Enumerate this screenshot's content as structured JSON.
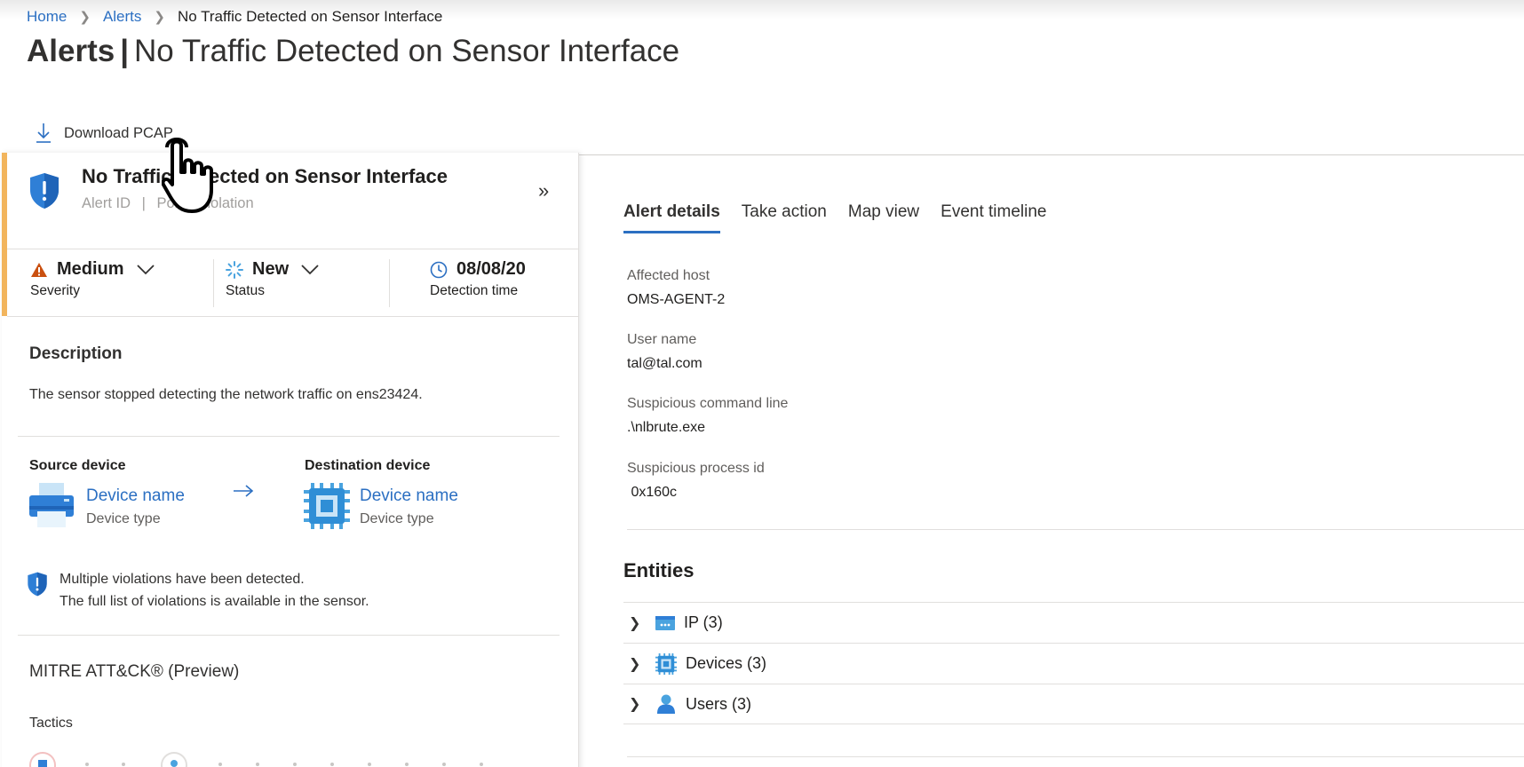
{
  "breadcrumb": {
    "home": "Home",
    "alerts": "Alerts",
    "current": "No Traffic Detected on Sensor Interface"
  },
  "page_title": {
    "prefix": "Alerts",
    "separator": "|",
    "name": "No Traffic Detected on Sensor Interface"
  },
  "command_bar": {
    "download_label": "Download PCAP",
    "icon": "download-icon"
  },
  "alert_panel": {
    "title": "No Traffic Detected on Sensor Interface",
    "alert_id_label": "Alert ID",
    "divider": "|",
    "policy_label": "Policy violation",
    "severity": {
      "value": "Medium",
      "label": "Severity",
      "color": "#ca5010"
    },
    "status": {
      "value": "New",
      "label": "Status"
    },
    "detection": {
      "value": "08/08/20",
      "label": "Detection time"
    },
    "accent_color": "#f2b55d",
    "description_title": "Description",
    "description_text": "The sensor stopped detecting the network traffic on ens23424.",
    "source": {
      "label": "Source device",
      "name": "Device name",
      "type": "Device type"
    },
    "destination": {
      "label": "Destination device",
      "name": "Device name",
      "type": "Device type"
    },
    "violations_line1": "Multiple violations have been detected.",
    "violations_line2": "The full list of violations is available in the sensor.",
    "mitre_title": "MITRE ATT&CK® (Preview)",
    "tactics_label": "Tactics"
  },
  "tabs": [
    {
      "label": "Alert details",
      "active": true
    },
    {
      "label": "Take action",
      "active": false
    },
    {
      "label": "Map view",
      "active": false
    },
    {
      "label": "Event timeline",
      "active": false
    }
  ],
  "details": {
    "affected_host_label": "Affected host",
    "affected_host_value": "OMS-AGENT-2",
    "user_name_label": "User name",
    "user_name_value": "tal@tal.com",
    "cmd_label": "Suspicious command line",
    "cmd_value": ".\\nlbrute.exe",
    "pid_label": "Suspicious process id",
    "pid_value": " 0x160c"
  },
  "entities": {
    "title": "Entities",
    "items": [
      {
        "label": "IP (3)",
        "icon": "ip-icon"
      },
      {
        "label": "Devices (3)",
        "icon": "chip-icon"
      },
      {
        "label": "Users (3)",
        "icon": "user-icon"
      }
    ]
  },
  "colors": {
    "link": "#2b6fc2",
    "accent": "#f2b55d"
  }
}
